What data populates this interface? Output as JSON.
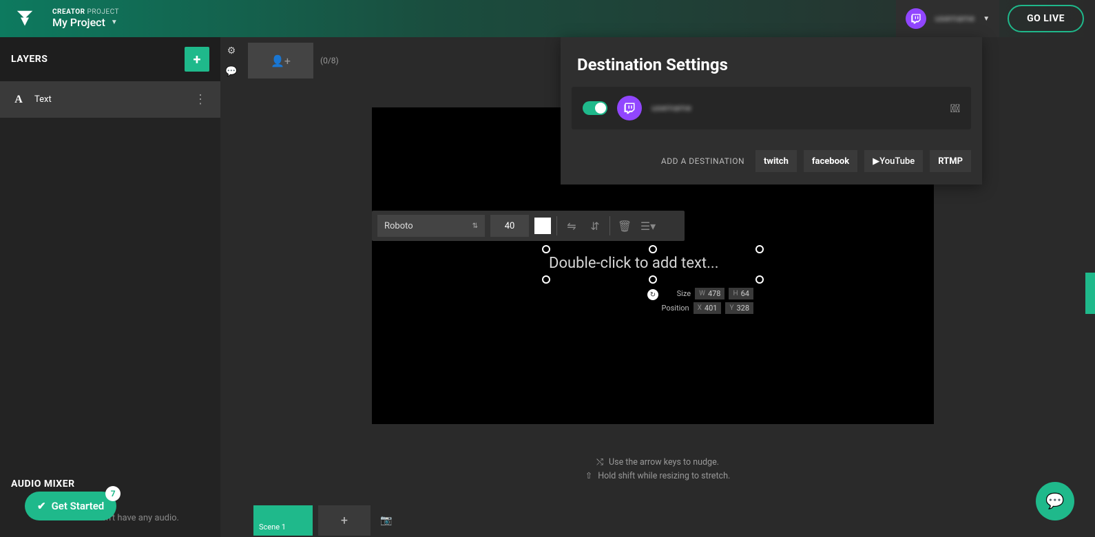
{
  "topbar": {
    "creator_label_bold": "CREATOR",
    "creator_label_light": "PROJECT",
    "project_name": "My Project",
    "username_blurred": "username",
    "go_live": "GO LIVE"
  },
  "layers": {
    "title": "LAYERS",
    "items": [
      {
        "name": "Text",
        "icon": "A"
      }
    ]
  },
  "audio": {
    "title": "AUDIO MIXER",
    "empty_text": "This scene doesn't have any audio."
  },
  "get_started": {
    "label": "Get Started",
    "badge": "7"
  },
  "thumbs": {
    "count": "(0/8)"
  },
  "text_toolbar": {
    "font": "Roboto",
    "size": "40",
    "color": "#ffffff"
  },
  "text_element": {
    "placeholder": "Double-click to add text...",
    "size_label": "Size",
    "position_label": "Position",
    "W": "478",
    "H": "64",
    "X": "401",
    "Y": "328"
  },
  "hints": {
    "line1": "Use the arrow keys to nudge.",
    "line2": "Hold shift while resizing to stretch."
  },
  "scenes": {
    "items": [
      {
        "name": "Scene 1"
      }
    ]
  },
  "destinations": {
    "title": "Destination Settings",
    "account_blurred": "username",
    "add_label": "ADD A DESTINATION",
    "buttons": {
      "twitch": "twitch",
      "facebook": "facebook",
      "youtube": "YouTube",
      "rtmp": "RTMP"
    }
  }
}
